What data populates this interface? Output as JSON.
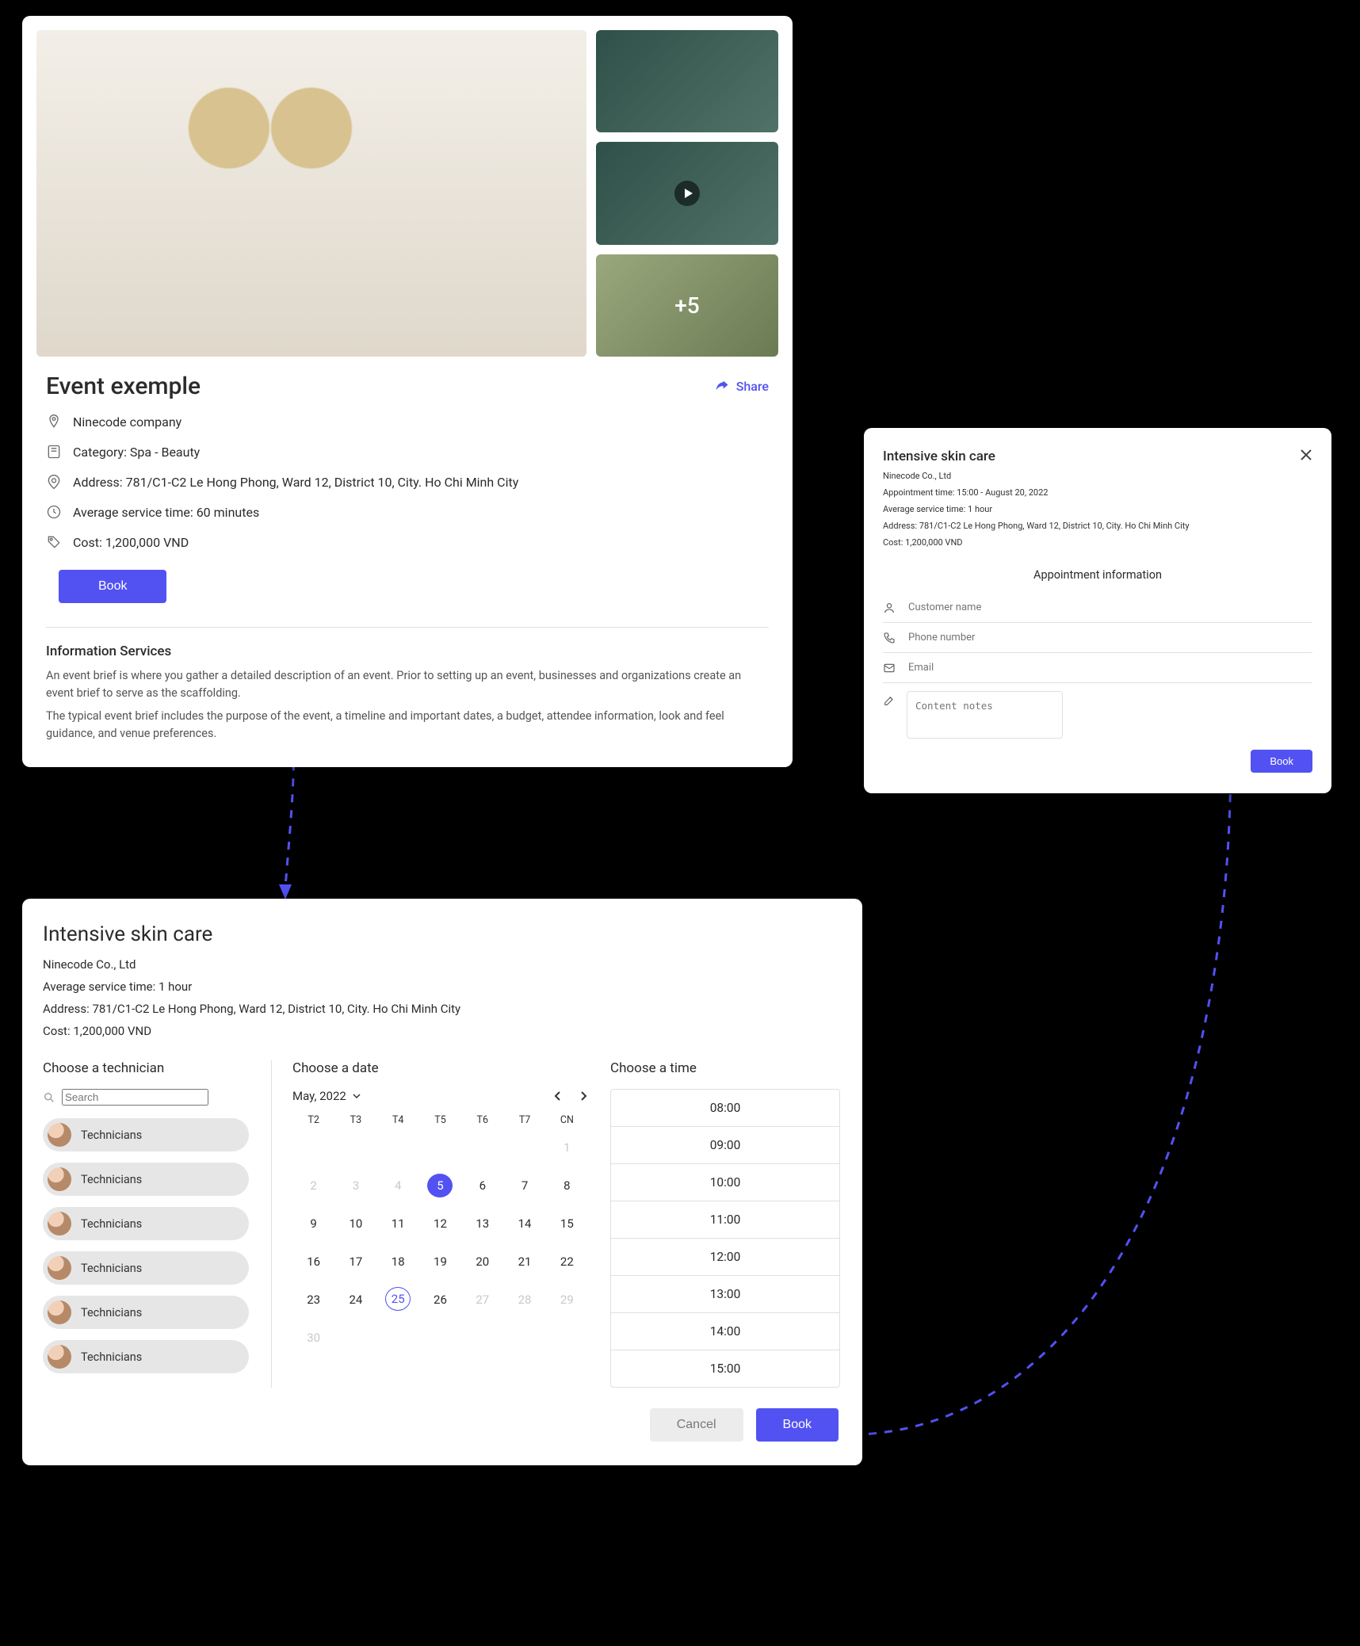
{
  "event": {
    "title": "Event exemple",
    "share_label": "Share",
    "book_label": "Book",
    "gallery_more": "+5",
    "meta": {
      "company": "Ninecode company",
      "category": "Category: Spa - Beauty",
      "address": "Address: 781/C1-C2 Le Hong Phong, Ward 12, District 10, City. Ho Chi Minh City",
      "avg_time": "Average service time: 60 minutes",
      "cost": "Cost: 1,200,000 VND"
    },
    "info_heading": "Information Services",
    "info_p1": "An event brief is where you gather a detailed description of an event. Prior to setting up an event, businesses and organizations create an event brief to serve as the scaffolding.",
    "info_p2": "The typical event brief includes the purpose of the event, a timeline and important dates, a budget, attendee information, look and feel guidance, and venue preferences."
  },
  "picker": {
    "title": "Intensive skin care",
    "company": "Ninecode Co., Ltd",
    "avg_time": "Average service time: 1 hour",
    "address": "Address: 781/C1-C2 Le Hong Phong, Ward 12, District 10, City. Ho Chi Minh City",
    "cost": "Cost: 1,200,000 VND",
    "tech_heading": "Choose a technician",
    "search_placeholder": "Search",
    "technicians": [
      "Technicians",
      "Technicians",
      "Technicians",
      "Technicians",
      "Technicians",
      "Technicians"
    ],
    "date_heading": "Choose a date",
    "month_label": "May, 2022",
    "dow": [
      "T2",
      "T3",
      "T4",
      "T5",
      "T6",
      "T7",
      "CN"
    ],
    "days": [
      {
        "n": "",
        "mute": true
      },
      {
        "n": "",
        "mute": true
      },
      {
        "n": "",
        "mute": true
      },
      {
        "n": "",
        "mute": true
      },
      {
        "n": "",
        "mute": true
      },
      {
        "n": "",
        "mute": true
      },
      {
        "n": "1",
        "mute": true
      },
      {
        "n": "2",
        "mute": true
      },
      {
        "n": "3",
        "mute": true
      },
      {
        "n": "4",
        "mute": true
      },
      {
        "n": "5",
        "sel": true
      },
      {
        "n": "6"
      },
      {
        "n": "7"
      },
      {
        "n": "8"
      },
      {
        "n": "9"
      },
      {
        "n": "10"
      },
      {
        "n": "11"
      },
      {
        "n": "12"
      },
      {
        "n": "13"
      },
      {
        "n": "14"
      },
      {
        "n": "15"
      },
      {
        "n": "16"
      },
      {
        "n": "17"
      },
      {
        "n": "18"
      },
      {
        "n": "19"
      },
      {
        "n": "20"
      },
      {
        "n": "21"
      },
      {
        "n": "22"
      },
      {
        "n": "23"
      },
      {
        "n": "24"
      },
      {
        "n": "25",
        "today": true
      },
      {
        "n": "26"
      },
      {
        "n": "27",
        "mute": true
      },
      {
        "n": "28",
        "mute": true
      },
      {
        "n": "29",
        "mute": true
      },
      {
        "n": "30",
        "mute": true
      }
    ],
    "time_heading": "Choose a time",
    "times": [
      "08:00",
      "09:00",
      "10:00",
      "11:00",
      "12:00",
      "13:00",
      "14:00",
      "15:00"
    ],
    "cancel_label": "Cancel",
    "book_label": "Book"
  },
  "form": {
    "title": "Intensive skin care",
    "lines": [
      "Ninecode Co., Ltd",
      "Appointment time: 15:00 - August 20, 2022",
      "Average service time: 1 hour",
      "Address: 781/C1-C2 Le Hong Phong, Ward 12, District 10, City. Ho Chi Minh City",
      "Cost: 1,200,000 VND"
    ],
    "section": "Appointment information",
    "ph_name": "Customer name",
    "ph_phone": "Phone number",
    "ph_email": "Email",
    "ph_notes": "Content notes",
    "book_label": "Book"
  }
}
